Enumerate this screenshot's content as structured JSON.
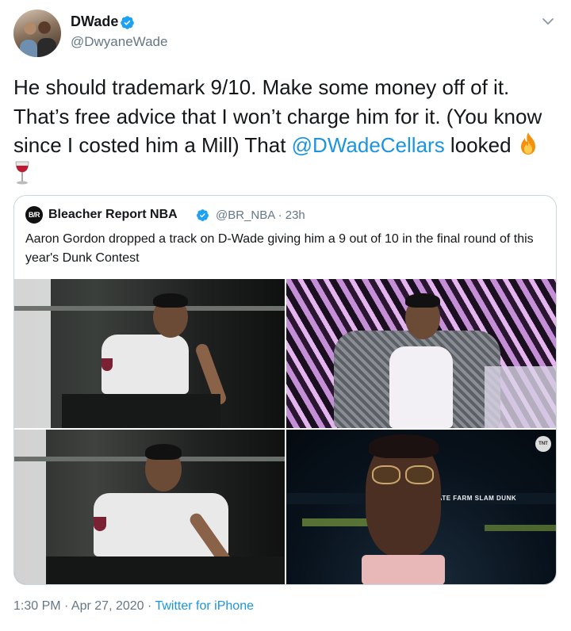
{
  "author": {
    "display_name": "DWade",
    "handle": "@DwyaneWade",
    "avatar_icon": "avatar-photo",
    "verified": true
  },
  "tweet": {
    "text_part1": "He should trademark 9/10. Make some money off of it. That’s free advice that I won’t charge him for it. (You know since I costed him a Mill)  That ",
    "mention": "@DWadeCellars",
    "text_part2": " looked ",
    "emojis": [
      "fire-icon",
      "wine-glass-icon"
    ]
  },
  "quoted_tweet": {
    "avatar_text": "B/R",
    "display_name": "Bleacher Report NBA",
    "verified": true,
    "handle_time": "@BR_NBA · 23h",
    "text": "Aaron Gordon dropped a track on D-Wade giving him a 9 out of 10 in the final round of this year's Dunk Contest",
    "media": [
      {
        "name": "video-still-balcony"
      },
      {
        "name": "video-still-zebra-wall"
      },
      {
        "name": "video-still-balcony-2"
      },
      {
        "name": "video-still-broadcast"
      }
    ],
    "broadcast_ticker": "STATE FARM SLAM DUNK",
    "broadcast_logo": "TNT"
  },
  "meta": {
    "timestamp": "1:30 PM · Apr 27, 2020 · ",
    "source": "Twitter for iPhone"
  },
  "colors": {
    "link": "#1b95e0",
    "secondary_text": "#657786",
    "border": "#ccd6dd",
    "verified_badge": "#1da1f2"
  }
}
